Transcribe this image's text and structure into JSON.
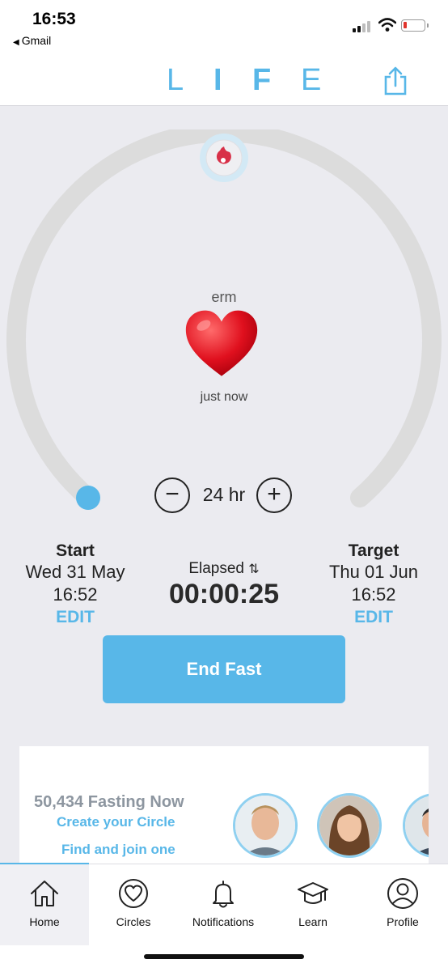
{
  "status_bar": {
    "time": "16:53",
    "back_label": "Gmail"
  },
  "header": {
    "logo_letters": [
      "L",
      "I",
      "F",
      "E"
    ],
    "share_icon": "share-icon",
    "accent_color": "#58b7e8"
  },
  "timer": {
    "mood_label": "erm",
    "mood_time": "just now",
    "mood_icon": "red-heart",
    "duration": "24 hr",
    "progress_fraction": 0.0003
  },
  "start": {
    "label": "Start",
    "date": "Wed 31 May",
    "time": "16:52",
    "edit": "EDIT"
  },
  "target": {
    "label": "Target",
    "date": "Thu 01 Jun",
    "time": "16:52",
    "edit": "EDIT"
  },
  "elapsed": {
    "label": "Elapsed",
    "value": "00:00:25"
  },
  "end_button": {
    "label": "End Fast"
  },
  "community": {
    "fasting_now": "50,434 Fasting Now",
    "create_circle": "Create your Circle",
    "find_join": "Find and join one"
  },
  "tabs": [
    {
      "label": "Home",
      "icon": "home-icon",
      "active": true
    },
    {
      "label": "Circles",
      "icon": "heart-circle-icon",
      "active": false
    },
    {
      "label": "Notifications",
      "icon": "bell-icon",
      "active": false
    },
    {
      "label": "Learn",
      "icon": "graduation-cap-icon",
      "active": false
    },
    {
      "label": "Profile",
      "icon": "user-icon",
      "active": false
    }
  ]
}
